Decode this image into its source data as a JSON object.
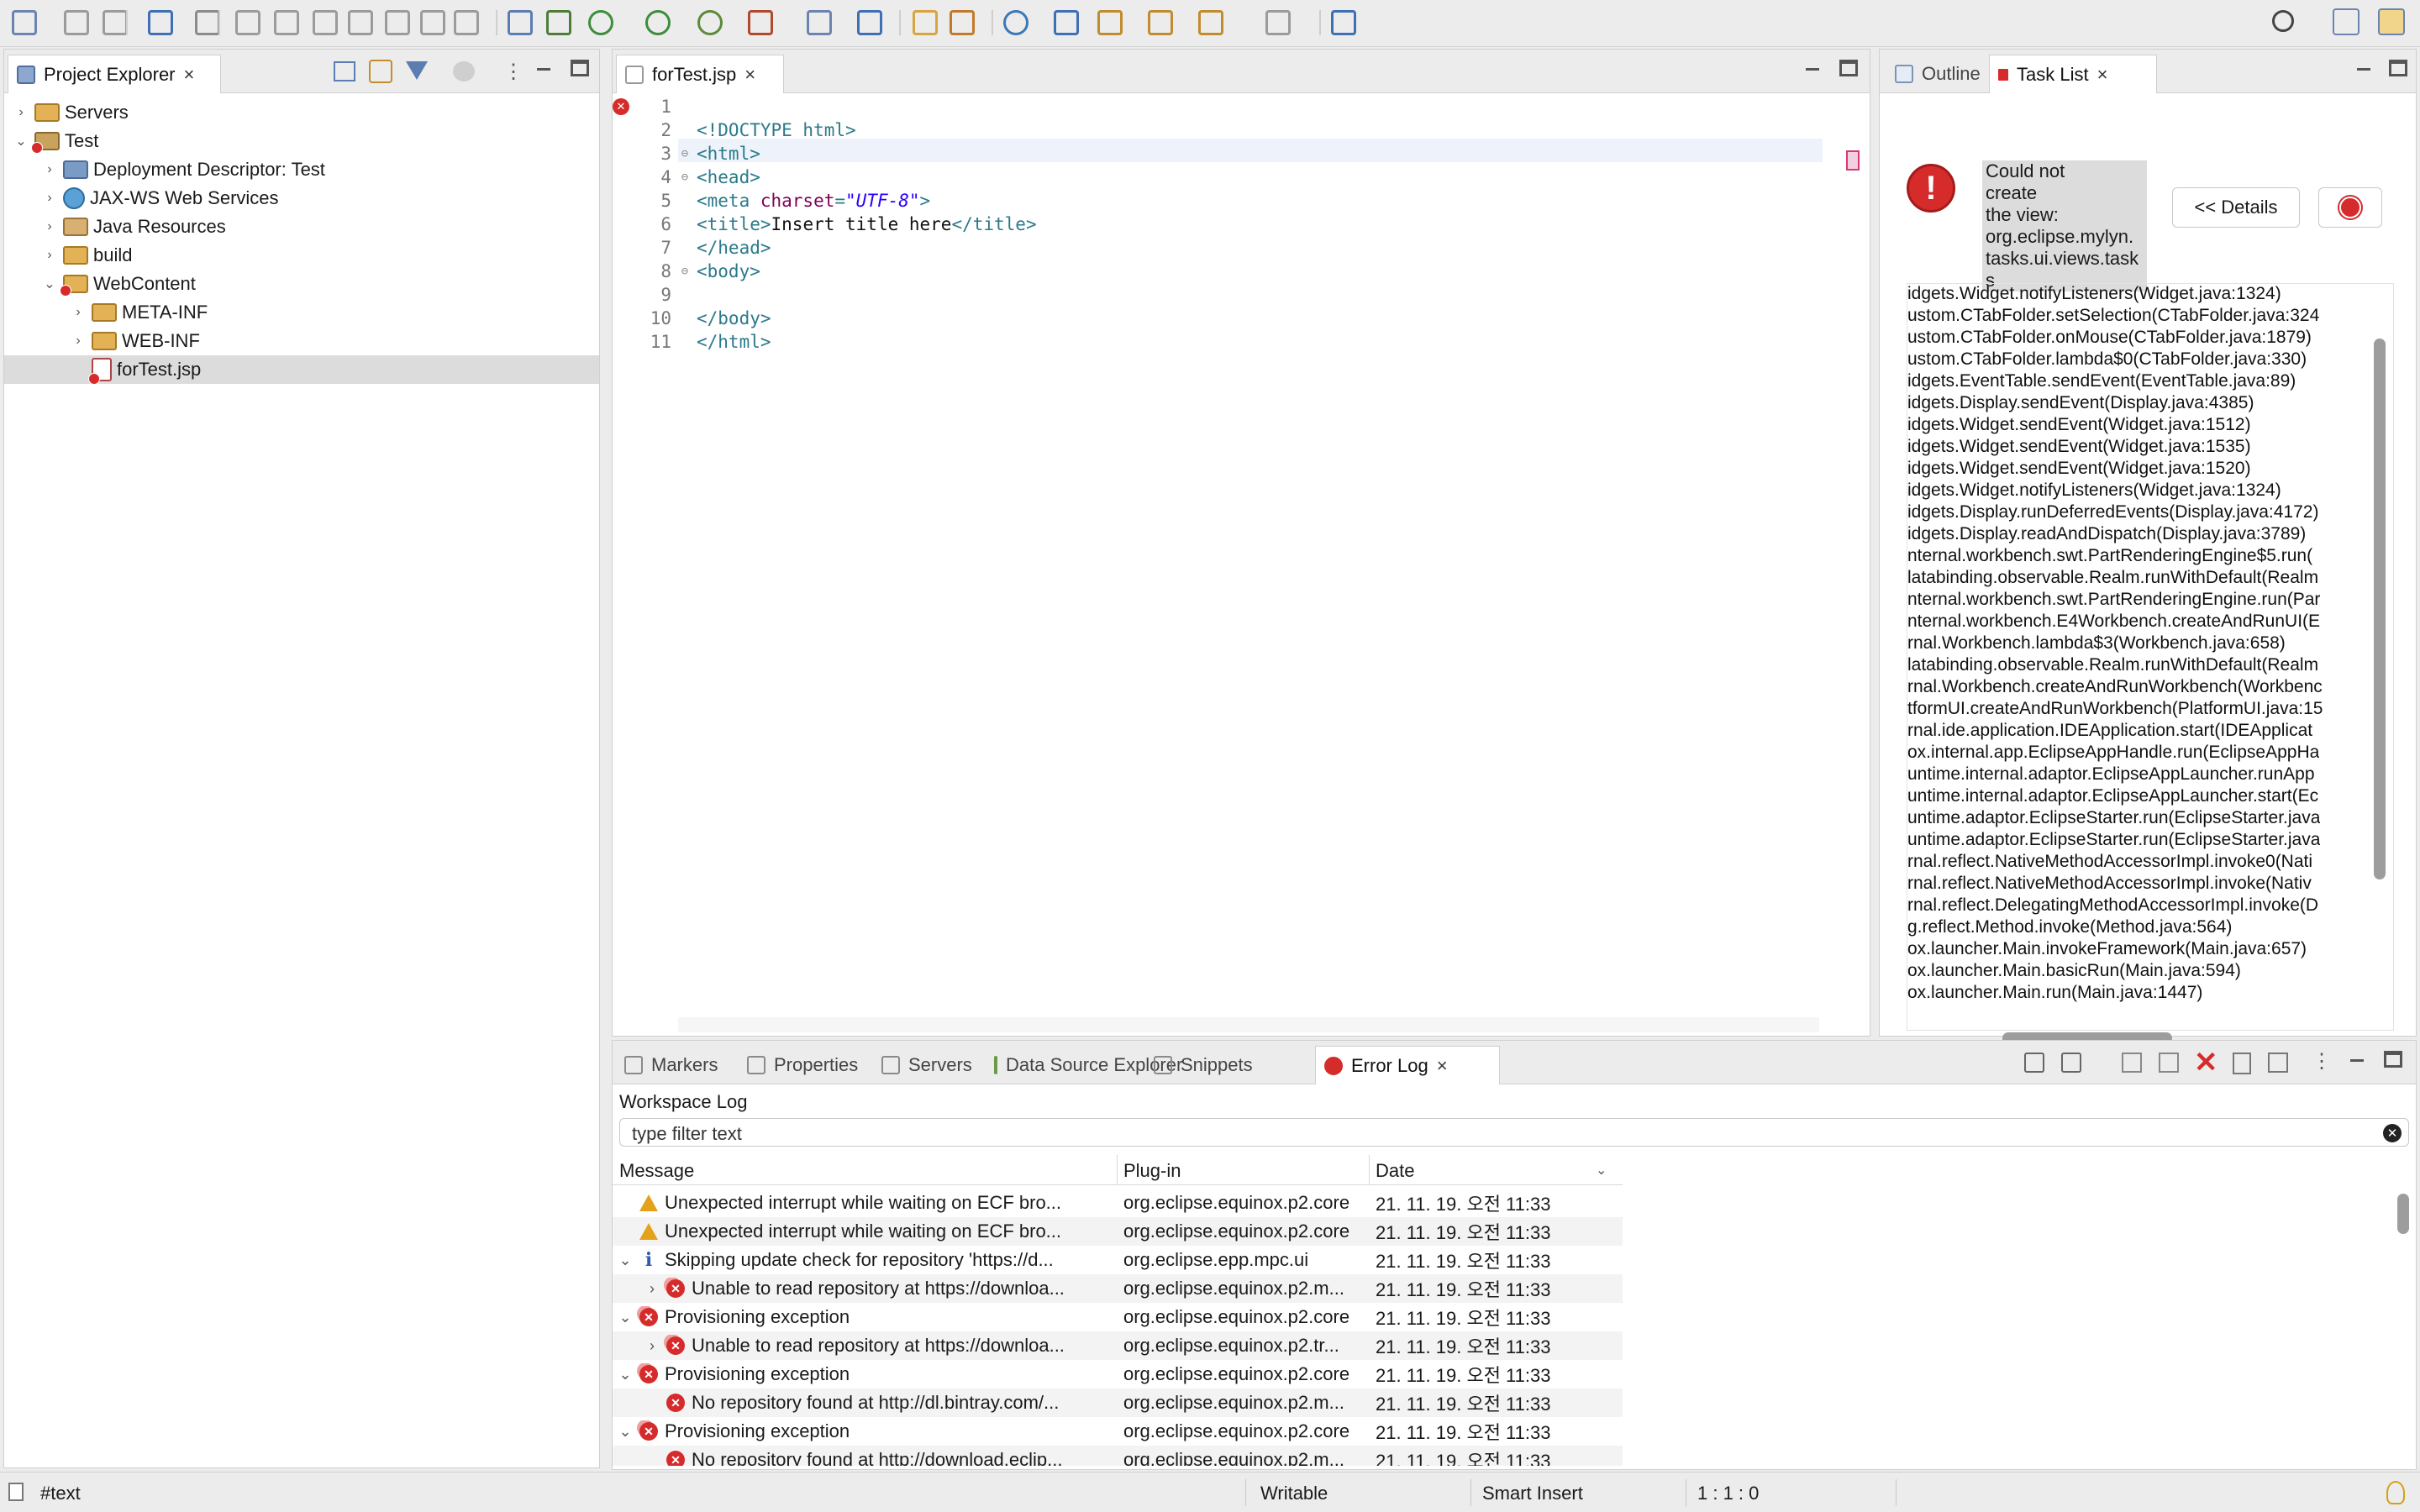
{
  "toolbar": {
    "icons": [
      "new-icon",
      "save-icon",
      "save-all-icon",
      "open-perspective-icon",
      "skip-breakpoints-icon",
      "resume-icon",
      "suspend-icon",
      "terminate-icon",
      "disconnect-icon",
      "step-into-icon",
      "step-over-icon",
      "step-return-icon",
      "annotate-icon",
      "open-type-icon",
      "debug-icon",
      "run-icon",
      "coverage-icon",
      "external-tools-icon",
      "new-server-icon",
      "new-web-service-icon",
      "open-folder-icon",
      "open-task-icon",
      "web-browser-icon",
      "search-icon",
      "next-annotation-icon",
      "prev-annotation-icon",
      "back-icon",
      "forward-icon",
      "pin-editor-icon"
    ],
    "search_icon": "search-icon",
    "perspective_icons": [
      "open-perspective-icon",
      "jee-perspective-icon"
    ]
  },
  "project_explorer": {
    "tab_label": "Project Explorer",
    "items": [
      {
        "label": "Servers",
        "icon": "folder-icon",
        "expanded": false,
        "selected": false
      },
      {
        "label": "Test",
        "icon": "project-icon",
        "expanded": true,
        "selected": false
      },
      {
        "label": "Deployment Descriptor: Test",
        "icon": "deployment-descriptor-icon",
        "expanded": false,
        "selected": false
      },
      {
        "label": "JAX-WS Web Services",
        "icon": "web-services-icon",
        "expanded": false,
        "selected": false
      },
      {
        "label": "Java Resources",
        "icon": "java-resources-icon",
        "expanded": false,
        "selected": false
      },
      {
        "label": "build",
        "icon": "folder-icon",
        "expanded": false,
        "selected": false
      },
      {
        "label": "WebContent",
        "icon": "folder-icon",
        "expanded": true,
        "selected": false
      },
      {
        "label": "META-INF",
        "icon": "folder-icon",
        "expanded": false,
        "selected": false
      },
      {
        "label": "WEB-INF",
        "icon": "folder-icon",
        "expanded": false,
        "selected": false
      },
      {
        "label": "forTest.jsp",
        "icon": "jsp-file-icon",
        "expanded": false,
        "selected": true
      }
    ]
  },
  "editor": {
    "tab_label": "forTest.jsp",
    "lines": [
      {
        "n": "1",
        "fold": false,
        "error": true,
        "tokens": []
      },
      {
        "n": "2",
        "fold": false,
        "error": false,
        "tokens": [
          {
            "t": "tag",
            "v": "<!DOCTYPE html>"
          }
        ]
      },
      {
        "n": "3",
        "fold": true,
        "error": false,
        "tokens": [
          {
            "t": "tag",
            "v": "<html>"
          }
        ]
      },
      {
        "n": "4",
        "fold": true,
        "error": false,
        "tokens": [
          {
            "t": "tag",
            "v": "<head>"
          }
        ]
      },
      {
        "n": "5",
        "fold": false,
        "error": false,
        "tokens": [
          {
            "t": "tag",
            "v": "<meta "
          },
          {
            "t": "attr",
            "v": "charset"
          },
          {
            "t": "tag",
            "v": "="
          },
          {
            "t": "str",
            "v": "\"UTF-8\""
          },
          {
            "t": "tag",
            "v": ">"
          }
        ]
      },
      {
        "n": "6",
        "fold": false,
        "error": false,
        "tokens": [
          {
            "t": "tag",
            "v": "<title>"
          },
          {
            "t": "txt",
            "v": "Insert title here"
          },
          {
            "t": "tag",
            "v": "</title>"
          }
        ]
      },
      {
        "n": "7",
        "fold": false,
        "error": false,
        "tokens": [
          {
            "t": "tag",
            "v": "</head>"
          }
        ]
      },
      {
        "n": "8",
        "fold": true,
        "error": false,
        "tokens": [
          {
            "t": "tag",
            "v": "<body>"
          }
        ]
      },
      {
        "n": "9",
        "fold": false,
        "error": false,
        "tokens": []
      },
      {
        "n": "10",
        "fold": false,
        "error": false,
        "tokens": [
          {
            "t": "tag",
            "v": "</body>"
          }
        ]
      },
      {
        "n": "11",
        "fold": false,
        "error": false,
        "tokens": [
          {
            "t": "tag",
            "v": "</html>"
          }
        ]
      }
    ]
  },
  "right_panel": {
    "tabs": [
      "Outline",
      "Task List"
    ],
    "error_message": "Could not create the view: org.eclipse.mylyn.tasks.ui.views.tasks",
    "error_message_lines": [
      "Could not",
      "create",
      "the view:",
      "org.eclipse.mylyn.",
      "tasks.ui.views.task",
      "s"
    ],
    "details_button": "<< Details",
    "stack_trace": [
      "idgets.Widget.notifyListeners(Widget.java:1324)",
      "ustom.CTabFolder.setSelection(CTabFolder.java:324",
      "ustom.CTabFolder.onMouse(CTabFolder.java:1879)",
      "ustom.CTabFolder.lambda$0(CTabFolder.java:330)",
      "idgets.EventTable.sendEvent(EventTable.java:89)",
      "idgets.Display.sendEvent(Display.java:4385)",
      "idgets.Widget.sendEvent(Widget.java:1512)",
      "idgets.Widget.sendEvent(Widget.java:1535)",
      "idgets.Widget.sendEvent(Widget.java:1520)",
      "idgets.Widget.notifyListeners(Widget.java:1324)",
      "idgets.Display.runDeferredEvents(Display.java:4172)",
      "idgets.Display.readAndDispatch(Display.java:3789)",
      "nternal.workbench.swt.PartRenderingEngine$5.run(",
      "latabinding.observable.Realm.runWithDefault(Realm",
      "nternal.workbench.swt.PartRenderingEngine.run(Par",
      "nternal.workbench.E4Workbench.createAndRunUI(E",
      "rnal.Workbench.lambda$3(Workbench.java:658)",
      "latabinding.observable.Realm.runWithDefault(Realm",
      "rnal.Workbench.createAndRunWorkbench(Workbenc",
      "tformUI.createAndRunWorkbench(PlatformUI.java:15",
      "rnal.ide.application.IDEApplication.start(IDEApplicat",
      "ox.internal.app.EclipseAppHandle.run(EclipseAppHa",
      "untime.internal.adaptor.EclipseAppLauncher.runApp",
      "untime.internal.adaptor.EclipseAppLauncher.start(Ec",
      "untime.adaptor.EclipseStarter.run(EclipseStarter.java",
      "untime.adaptor.EclipseStarter.run(EclipseStarter.java",
      "rnal.reflect.NativeMethodAccessorImpl.invoke0(Nati",
      "rnal.reflect.NativeMethodAccessorImpl.invoke(Nativ",
      "rnal.reflect.DelegatingMethodAccessorImpl.invoke(D",
      "g.reflect.Method.invoke(Method.java:564)",
      "ox.launcher.Main.invokeFramework(Main.java:657)",
      "ox.launcher.Main.basicRun(Main.java:594)",
      "ox.launcher.Main.run(Main.java:1447)"
    ]
  },
  "bottom_panel": {
    "tabs": [
      {
        "label": "Markers",
        "icon": "markers-icon"
      },
      {
        "label": "Properties",
        "icon": "properties-icon"
      },
      {
        "label": "Servers",
        "icon": "servers-icon"
      },
      {
        "label": "Data Source Explorer",
        "icon": "data-source-icon"
      },
      {
        "label": "Snippets",
        "icon": "snippets-icon"
      },
      {
        "label": "Error Log",
        "icon": "error-log-icon"
      }
    ],
    "active_tab": "Error Log",
    "workspace_label": "Workspace Log",
    "filter_placeholder": "type filter text",
    "columns": [
      "Message",
      "Plug-in",
      "Date"
    ],
    "rows": [
      {
        "indent": 0,
        "twisty": "",
        "severity": "warning",
        "message": "Unexpected interrupt while waiting on ECF bro...",
        "plugin": "org.eclipse.equinox.p2.core",
        "date": "21. 11. 19. 오전 11:33"
      },
      {
        "indent": 0,
        "twisty": "",
        "severity": "warning",
        "message": "Unexpected interrupt while waiting on ECF bro...",
        "plugin": "org.eclipse.equinox.p2.core",
        "date": "21. 11. 19. 오전 11:33"
      },
      {
        "indent": 0,
        "twisty": "open",
        "severity": "info",
        "message": "Skipping update check for repository 'https://d...",
        "plugin": "org.eclipse.epp.mpc.ui",
        "date": "21. 11. 19. 오전 11:33"
      },
      {
        "indent": 1,
        "twisty": "closed",
        "severity": "error-multi",
        "message": "Unable to read repository at https://downloa...",
        "plugin": "org.eclipse.equinox.p2.m...",
        "date": "21. 11. 19. 오전 11:33"
      },
      {
        "indent": 0,
        "twisty": "open",
        "severity": "error-multi",
        "message": "Provisioning exception",
        "plugin": "org.eclipse.equinox.p2.core",
        "date": "21. 11. 19. 오전 11:33"
      },
      {
        "indent": 1,
        "twisty": "closed",
        "severity": "error-multi",
        "message": "Unable to read repository at https://downloa...",
        "plugin": "org.eclipse.equinox.p2.tr...",
        "date": "21. 11. 19. 오전 11:33"
      },
      {
        "indent": 0,
        "twisty": "open",
        "severity": "error-multi",
        "message": "Provisioning exception",
        "plugin": "org.eclipse.equinox.p2.core",
        "date": "21. 11. 19. 오전 11:33"
      },
      {
        "indent": 1,
        "twisty": "",
        "severity": "error",
        "message": "No repository found at http://dl.bintray.com/...",
        "plugin": "org.eclipse.equinox.p2.m...",
        "date": "21. 11. 19. 오전 11:33"
      },
      {
        "indent": 0,
        "twisty": "open",
        "severity": "error-multi",
        "message": "Provisioning exception",
        "plugin": "org.eclipse.equinox.p2.core",
        "date": "21. 11. 19. 오전 11:33"
      },
      {
        "indent": 1,
        "twisty": "",
        "severity": "error",
        "message": "No repository found at http://download.eclip...",
        "plugin": "org.eclipse.equinox.p2.m...",
        "date": "21. 11. 19. 오전 11:33"
      }
    ]
  },
  "status_bar": {
    "selection": "#text",
    "mode": "Writable",
    "insert_mode": "Smart Insert",
    "position": "1 : 1 : 0"
  },
  "colors": {
    "error": "#d62b2b",
    "warning": "#e3a21a",
    "info": "#2b5db3",
    "tag": "#2a7a8a",
    "attr": "#7f0055",
    "string": "#2a00ff"
  }
}
